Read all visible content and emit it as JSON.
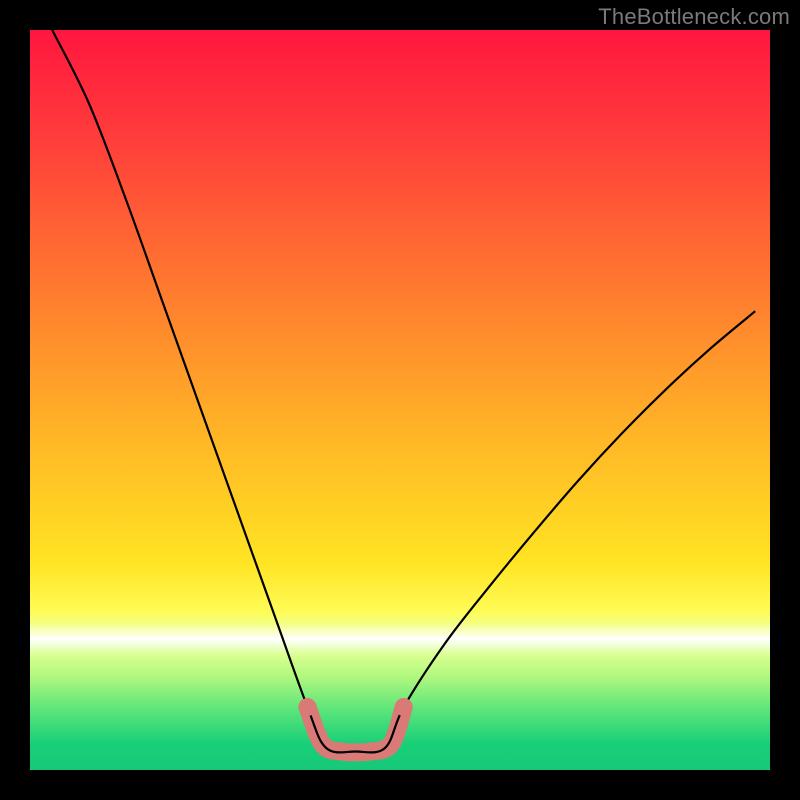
{
  "watermark": "TheBottleneck.com",
  "chart_data": {
    "type": "line",
    "title": "",
    "xlabel": "",
    "ylabel": "",
    "xlim": [
      0,
      1
    ],
    "ylim": [
      0,
      1
    ],
    "notes": "Bottleneck curve: two quasi-parabolic arms dipping to a flat minimum at ~x≈0.40–0.48, over a rainbow vertical gradient (red→yellow→green) with a bright horizontal band near y≈0.18–0.22. A thick salmon-colored U overlay marks the minimum region.",
    "series": [
      {
        "name": "left_arm",
        "x": [
          0.03,
          0.08,
          0.13,
          0.18,
          0.23,
          0.28,
          0.33,
          0.375
        ],
        "y": [
          1.0,
          0.9,
          0.77,
          0.63,
          0.49,
          0.35,
          0.21,
          0.085
        ]
      },
      {
        "name": "floor",
        "x": [
          0.375,
          0.4,
          0.44,
          0.48,
          0.505
        ],
        "y": [
          0.085,
          0.03,
          0.025,
          0.03,
          0.085
        ]
      },
      {
        "name": "right_arm",
        "x": [
          0.505,
          0.56,
          0.62,
          0.68,
          0.74,
          0.8,
          0.86,
          0.92,
          0.98
        ],
        "y": [
          0.085,
          0.17,
          0.247,
          0.32,
          0.39,
          0.455,
          0.515,
          0.57,
          0.62
        ]
      },
      {
        "name": "u_overlay",
        "x": [
          0.375,
          0.395,
          0.42,
          0.46,
          0.488,
          0.505
        ],
        "y": [
          0.085,
          0.035,
          0.025,
          0.025,
          0.035,
          0.085
        ]
      }
    ],
    "gradient_stops": [
      {
        "offset": 0.0,
        "color": "#ff163f"
      },
      {
        "offset": 0.15,
        "color": "#ff3e3b"
      },
      {
        "offset": 0.35,
        "color": "#ff7a2f"
      },
      {
        "offset": 0.55,
        "color": "#ffb626"
      },
      {
        "offset": 0.72,
        "color": "#ffe423"
      },
      {
        "offset": 0.785,
        "color": "#fffb55"
      },
      {
        "offset": 0.8,
        "color": "#f4ff7a"
      },
      {
        "offset": 0.823,
        "color": "#ffffff"
      },
      {
        "offset": 0.845,
        "color": "#d8ff8f"
      },
      {
        "offset": 0.875,
        "color": "#aef77e"
      },
      {
        "offset": 0.92,
        "color": "#59e47a"
      },
      {
        "offset": 0.965,
        "color": "#18cf78"
      },
      {
        "offset": 1.0,
        "color": "#17c878"
      }
    ],
    "u_color": "#d97a76",
    "curve_color": "#000000"
  }
}
